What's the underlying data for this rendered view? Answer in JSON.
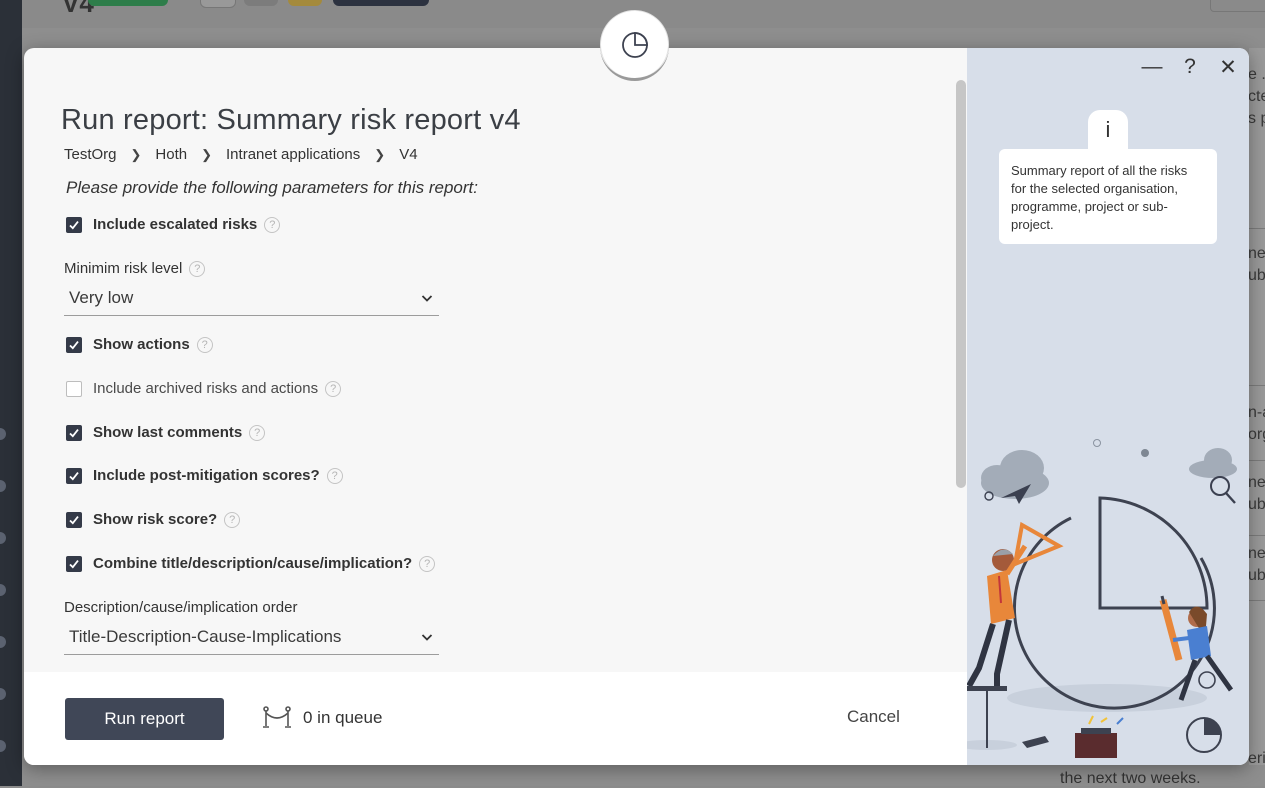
{
  "background": {
    "title": "V4",
    "right_snippets": [
      "e .",
      "cte",
      "s p",
      "ne",
      "ub",
      "n-a",
      "org",
      "ne",
      "ub",
      "ne",
      "ub",
      "eri"
    ],
    "bottom_snippet": "the next two weeks."
  },
  "modal": {
    "title": "Run report: Summary risk report v4",
    "breadcrumb": [
      "TestOrg",
      "Hoth",
      "Intranet applications",
      "V4"
    ],
    "intro": "Please provide the following parameters for this report:",
    "params": {
      "escalated": {
        "label": "Include escalated risks",
        "checked": true
      },
      "min_level": {
        "label": "Minimim risk level",
        "value": "Very low"
      },
      "show_actions": {
        "label": "Show actions",
        "checked": true
      },
      "archived": {
        "label": "Include archived risks and actions",
        "checked": false
      },
      "last_comments": {
        "label": "Show last comments",
        "checked": true
      },
      "post_mitigation": {
        "label": "Include post-mitigation scores?",
        "checked": true
      },
      "risk_score": {
        "label": "Show risk score?",
        "checked": true
      },
      "combine": {
        "label": "Combine title/description/cause/implication?",
        "checked": true
      },
      "order": {
        "label": "Description/cause/implication order",
        "value": "Title-Description-Cause-Implications"
      }
    },
    "help_glyph": "?",
    "footer": {
      "run_label": "Run report",
      "queue_text": "0 in queue",
      "cancel_label": "Cancel"
    },
    "side_panel": {
      "minimize": "—",
      "help": "?",
      "close": "✕",
      "info_glyph": "i",
      "description": "Summary report of all the risks for the selected organisation, programme, project or sub-project."
    }
  },
  "colors": {
    "primary_button": "#404757",
    "checkbox": "#343a48",
    "side_panel_bg": "#d7dee9",
    "accent_orange": "#e8873a",
    "accent_blue": "#4a7fd1"
  }
}
